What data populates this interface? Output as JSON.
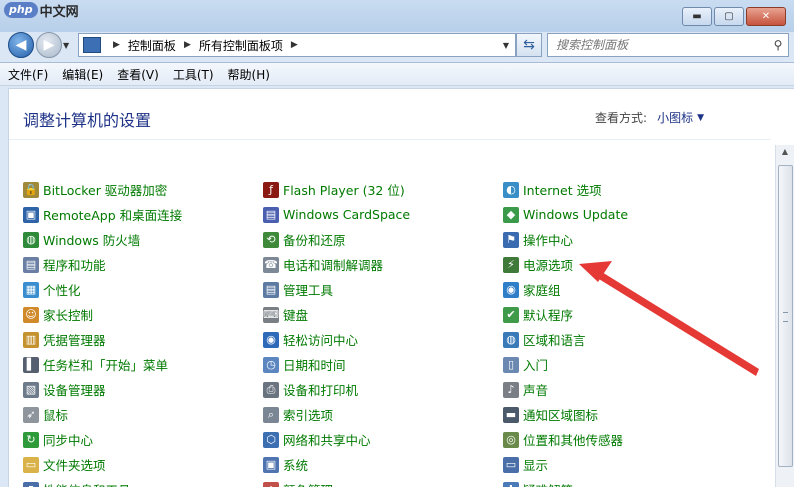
{
  "watermark": {
    "logo": "php",
    "text": "中文网"
  },
  "window_controls": {
    "minimize": "▬",
    "maximize": "▢",
    "close": "✕"
  },
  "address": {
    "segment1": "控制面板",
    "segment2": "所有控制面板项"
  },
  "search": {
    "placeholder": "搜索控制面板"
  },
  "menu": [
    "文件(F)",
    "编辑(E)",
    "查看(V)",
    "工具(T)",
    "帮助(H)"
  ],
  "page_title": "调整计算机的设置",
  "view_by": {
    "label": "查看方式:",
    "value": "小图标"
  },
  "items": {
    "col1": [
      {
        "label": "BitLocker 驱动器加密",
        "icon": "bitlocker-icon",
        "color": "#a08a3a"
      },
      {
        "label": "RemoteApp 和桌面连接",
        "icon": "remoteapp-icon",
        "color": "#2e63a8"
      },
      {
        "label": "Windows 防火墙",
        "icon": "firewall-icon",
        "color": "#2f8a3a"
      },
      {
        "label": "程序和功能",
        "icon": "programs-icon",
        "color": "#6a7fa3"
      },
      {
        "label": "个性化",
        "icon": "personalization-icon",
        "color": "#3a8ecf"
      },
      {
        "label": "家长控制",
        "icon": "parental-control-icon",
        "color": "#d08a2a"
      },
      {
        "label": "凭据管理器",
        "icon": "credential-manager-icon",
        "color": "#c4922e"
      },
      {
        "label": "任务栏和「开始」菜单",
        "icon": "taskbar-icon",
        "color": "#555f70"
      },
      {
        "label": "设备管理器",
        "icon": "device-manager-icon",
        "color": "#6c7a8a"
      },
      {
        "label": "鼠标",
        "icon": "mouse-icon",
        "color": "#8e959d"
      },
      {
        "label": "同步中心",
        "icon": "sync-center-icon",
        "color": "#2f9a3a"
      },
      {
        "label": "文件夹选项",
        "icon": "folder-options-icon",
        "color": "#d9b24a"
      },
      {
        "label": "性能信息和工具",
        "icon": "performance-icon",
        "color": "#4a6fa8"
      }
    ],
    "col2": [
      {
        "label": "Flash Player (32 位)",
        "icon": "flash-icon",
        "color": "#8a1a12"
      },
      {
        "label": "Windows CardSpace",
        "icon": "cardspace-icon",
        "color": "#4a5fb0"
      },
      {
        "label": "备份和还原",
        "icon": "backup-icon",
        "color": "#3f8a3a"
      },
      {
        "label": "电话和调制解调器",
        "icon": "phone-modem-icon",
        "color": "#7d8896"
      },
      {
        "label": "管理工具",
        "icon": "admin-tools-icon",
        "color": "#5d7aa3"
      },
      {
        "label": "键盘",
        "icon": "keyboard-icon",
        "color": "#7a7f86"
      },
      {
        "label": "轻松访问中心",
        "icon": "ease-of-access-icon",
        "color": "#2e6ab8"
      },
      {
        "label": "日期和时间",
        "icon": "date-time-icon",
        "color": "#5b86c0"
      },
      {
        "label": "设备和打印机",
        "icon": "printer-icon",
        "color": "#6a7380"
      },
      {
        "label": "索引选项",
        "icon": "indexing-icon",
        "color": "#7a8694"
      },
      {
        "label": "网络和共享中心",
        "icon": "network-icon",
        "color": "#3b6fb2"
      },
      {
        "label": "系统",
        "icon": "system-icon",
        "color": "#4f74b0"
      },
      {
        "label": "颜色管理",
        "icon": "color-management-icon",
        "color": "#c2504a"
      }
    ],
    "col3": [
      {
        "label": "Internet 选项",
        "icon": "internet-options-icon",
        "color": "#3a8ec8"
      },
      {
        "label": "Windows Update",
        "icon": "windows-update-icon",
        "color": "#3a9a4a"
      },
      {
        "label": "操作中心",
        "icon": "action-center-icon",
        "color": "#3a6ab0"
      },
      {
        "label": "电源选项",
        "icon": "power-options-icon",
        "color": "#3f7a3a"
      },
      {
        "label": "家庭组",
        "icon": "homegroup-icon",
        "color": "#2f7ec8"
      },
      {
        "label": "默认程序",
        "icon": "default-programs-icon",
        "color": "#3f9a4a"
      },
      {
        "label": "区域和语言",
        "icon": "region-language-icon",
        "color": "#3a7ab8"
      },
      {
        "label": "入门",
        "icon": "getting-started-icon",
        "color": "#6a88b0"
      },
      {
        "label": "声音",
        "icon": "sound-icon",
        "color": "#7a7f86"
      },
      {
        "label": "通知区域图标",
        "icon": "notification-area-icon",
        "color": "#4b5a6b"
      },
      {
        "label": "位置和其他传感器",
        "icon": "location-sensors-icon",
        "color": "#6a8a4a"
      },
      {
        "label": "显示",
        "icon": "display-icon",
        "color": "#4a6fa8"
      },
      {
        "label": "疑难解答",
        "icon": "troubleshooting-icon",
        "color": "#4a7ab8"
      }
    ]
  }
}
